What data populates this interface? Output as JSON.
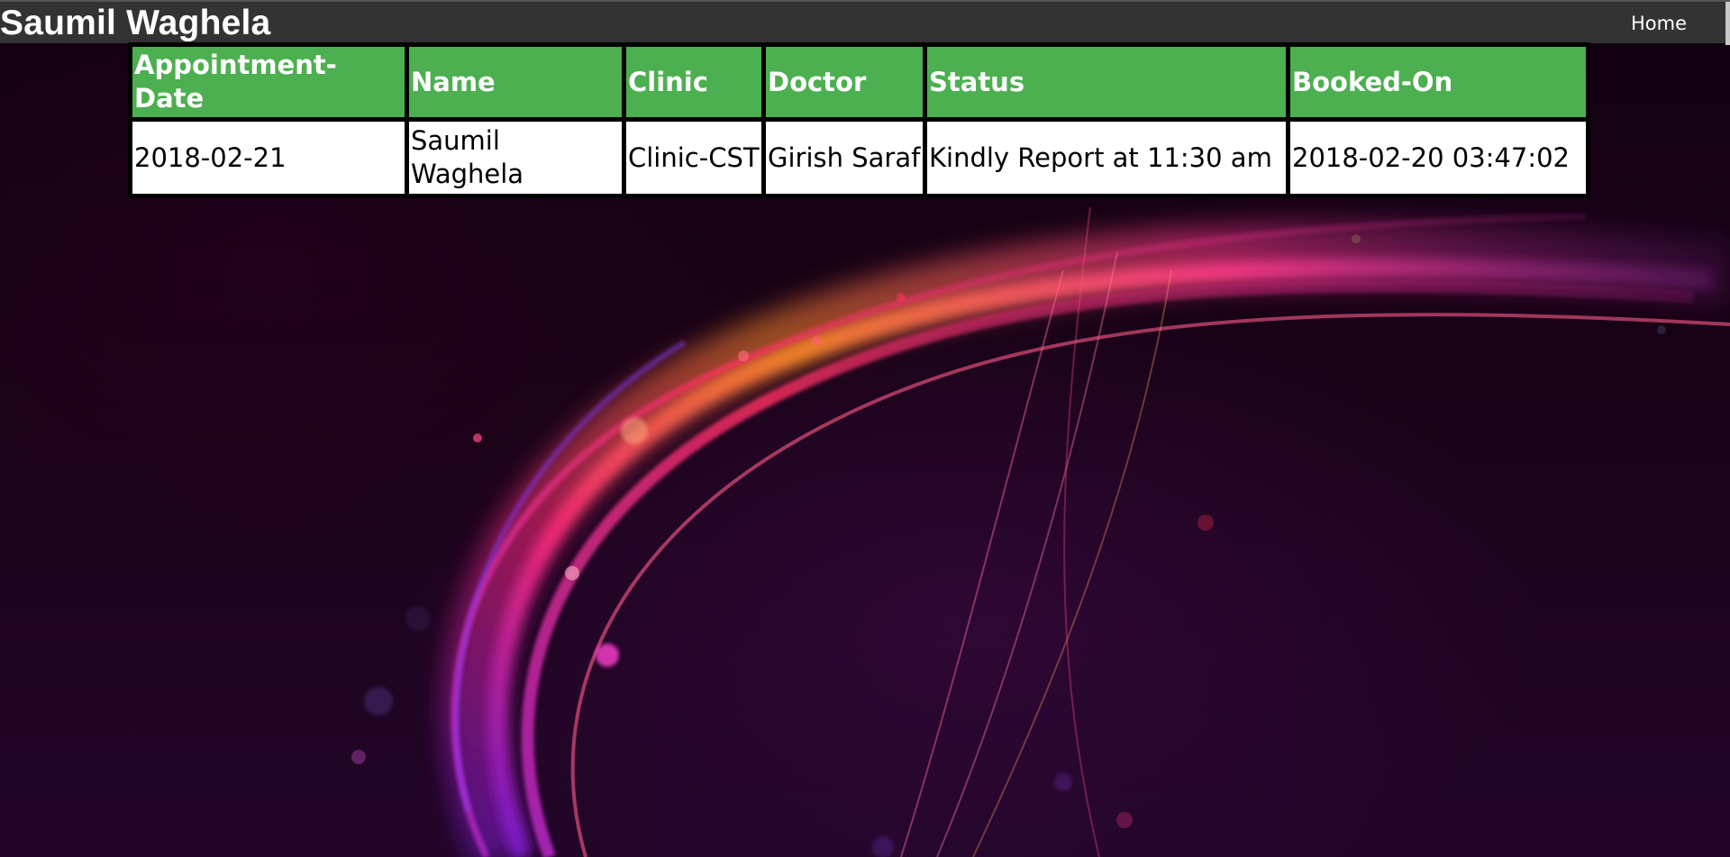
{
  "header": {
    "brand": "Saumil Waghela",
    "nav": [
      {
        "label": "Home"
      }
    ]
  },
  "appointments": {
    "columns": [
      "Appointment-Date",
      "Name",
      "Clinic",
      "Doctor",
      "Status",
      "Booked-On"
    ],
    "rows": [
      [
        "2018-02-21",
        "Saumil Waghela",
        "Clinic-CST",
        "Girish Saraf",
        "Kindly Report at 11:30 am",
        "2018-02-20 03:47:02"
      ]
    ]
  },
  "colors": {
    "header_bar": "#333333",
    "table_header_bg": "#4caf50",
    "table_border": "#000000"
  }
}
